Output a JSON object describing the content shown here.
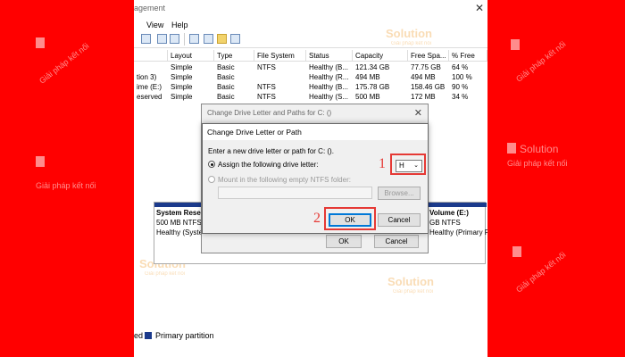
{
  "app": {
    "title_fragment": "agement"
  },
  "menu": {
    "view": "View",
    "help": "Help"
  },
  "columns": [
    "Layout",
    "Type",
    "File System",
    "Status",
    "Capacity",
    "Free Spa...",
    "% Free"
  ],
  "rows": [
    {
      "volume": "",
      "layout": "Simple",
      "type": "Basic",
      "fs": "NTFS",
      "status": "Healthy (B...",
      "capacity": "121.34 GB",
      "free": "77.75 GB",
      "pct": "64 %"
    },
    {
      "volume": "tion 3)",
      "layout": "Simple",
      "type": "Basic",
      "fs": "",
      "status": "Healthy (R...",
      "capacity": "494 MB",
      "free": "494 MB",
      "pct": "100 %"
    },
    {
      "volume": "ime (E:)",
      "layout": "Simple",
      "type": "Basic",
      "fs": "NTFS",
      "status": "Healthy (B...",
      "capacity": "175.78 GB",
      "free": "158.46 GB",
      "pct": "90 %"
    },
    {
      "volume": "eserved",
      "layout": "Simple",
      "type": "Basic",
      "fs": "NTFS",
      "status": "Healthy (S...",
      "capacity": "500 MB",
      "free": "172 MB",
      "pct": "34 %"
    }
  ],
  "disk": {
    "left": {
      "name": "System Rese",
      "size": "500 MB NTFS",
      "status": "Healthy (Syste"
    },
    "right": {
      "name": "Volume  (E:)",
      "size": "GB NTFS",
      "status": "Healthy (Primary Partition"
    }
  },
  "legend": {
    "prefix": "ed",
    "primary": "Primary partition"
  },
  "bg_dialog": {
    "title": "Change Drive Letter and Paths for C: ()",
    "ok": "OK",
    "cancel": "Cancel"
  },
  "dialog": {
    "title": "Change Drive Letter or Path",
    "prompt": "Enter a new drive letter or path for C: ().",
    "assign_label": "Assign the following drive letter:",
    "mount_label": "Mount in the following empty NTFS folder:",
    "drive_letter": "H",
    "browse": "Browse...",
    "ok": "OK",
    "cancel": "Cancel"
  },
  "callouts": {
    "one": "1",
    "two": "2"
  },
  "watermark": {
    "brand": "Solution",
    "tagline": "Giải pháp kết nối"
  },
  "colors": {
    "background": "#ff0000",
    "partition": "#1b3a8c",
    "highlight": "#e53935",
    "accent": "#0078d7"
  }
}
